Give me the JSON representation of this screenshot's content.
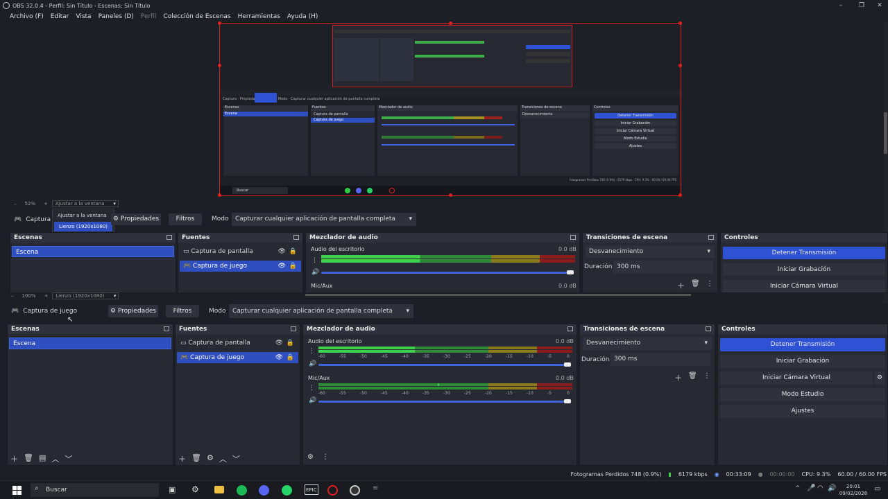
{
  "window": {
    "title": "OBS 32.0.4 - Perfil: Sin Título - Escenas: Sin Título",
    "min": "–",
    "max": "❐",
    "close": "✕"
  },
  "menu": [
    "Archivo (F)",
    "Editar",
    "Vista",
    "Paneles (D)",
    "Perfil",
    "Colección de Escenas",
    "Herramientas",
    "Ayuda (H)"
  ],
  "top": {
    "zoom": "52%",
    "plus": "+",
    "fit_label": "Ajustar a la ventana",
    "dropdown": {
      "item1": "Ajustar a la ventana",
      "item2": "Lienzo (1920x1080)"
    },
    "source_name": "Captura",
    "props": "Propiedades",
    "filters": "Filtros",
    "mode_label": "Modo",
    "mode_value": "Capturar cualquier aplicación de pantalla completa",
    "scenes_title": "Escenas",
    "scene": "Escena",
    "sources_title": "Fuentes",
    "src1": "Captura de pantalla",
    "src2": "Captura de juego",
    "mixer_title": "Mezclador de audio",
    "ch1": "Audio del escritorio",
    "ch1_db": "0.0 dB",
    "ch2": "Mic/Aux",
    "ch2_db": "0.0 dB",
    "trans_title": "Transiciones de escena",
    "trans_value": "Desvanecimiento",
    "duration_label": "Duración",
    "duration_value": "300 ms",
    "controls_title": "Controles",
    "c1": "Detener Transmisión",
    "c2": "Iniciar Grabación",
    "c3": "Iniciar Cámara Virtual"
  },
  "bottom": {
    "zoom": "100%",
    "plus": "+",
    "canvas_label": "Lienzo (1920x1080)",
    "source_name": "Captura de juego",
    "props": "Propiedades",
    "filters": "Filtros",
    "mode_label": "Modo",
    "mode_value": "Capturar cualquier aplicación de pantalla completa",
    "scenes_title": "Escenas",
    "scene": "Escena",
    "sources_title": "Fuentes",
    "src1": "Captura de pantalla",
    "src2": "Captura de juego",
    "mixer_title": "Mezclador de audio",
    "ch1": "Audio del escritorio",
    "ch1_db": "0.0 dB",
    "ch2": "Mic/Aux",
    "ch2_db": "0.0 dB",
    "trans_title": "Transiciones de escena",
    "trans_value": "Desvanecimiento",
    "duration_label": "Duración",
    "duration_value": "300 ms",
    "controls_title": "Controles",
    "c1": "Detener Transmisión",
    "c2": "Iniciar Grabación",
    "c3": "Iniciar Cámara Virtual",
    "c4": "Modo Estudio",
    "c5": "Ajustes"
  },
  "meter_ticks": [
    "-60",
    "-55",
    "-50",
    "-45",
    "-40",
    "-35",
    "-30",
    "-25",
    "-20",
    "-15",
    "-10",
    "-5",
    "0"
  ],
  "status": {
    "dropped": "Fotogramas Perdidos 748 (0.9%)",
    "kbps": "6179 kbps",
    "stream_time": "00:33:09",
    "rec_time": "00:00:00",
    "cpu": "CPU: 9.3%",
    "fps": "60.00 / 60.00 FPS"
  },
  "taskbar": {
    "search": "Buscar",
    "time": "20:01",
    "date": "09/02/2026"
  },
  "nested_preview": {
    "scenes": "Escenas",
    "scene": "Escena",
    "sources": "Fuentes",
    "src1": "Captura de pantalla",
    "src2": "Captura de juego",
    "mixer": "Mezclador de audio",
    "trans": "Transiciones de escena",
    "trans_value": "Desvanecimiento",
    "controls": "Controles",
    "c1": "Detener Transmisión",
    "c2": "Iniciar Grabación",
    "c3": "Iniciar Cámara Virtual",
    "c4": "Modo Estudio",
    "c5": "Ajustes",
    "search": "Buscar"
  }
}
